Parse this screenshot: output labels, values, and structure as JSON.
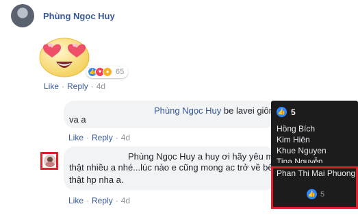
{
  "comment": {
    "author": "Phùng Ngọc Huy",
    "reaction_count": "65",
    "actions": {
      "like": "Like",
      "reply": "Reply",
      "time": "4d"
    }
  },
  "reply1": {
    "name": "Phùng Ngọc Huy",
    "text_inline": " be lavei giôn",
    "text_line2": "va a",
    "actions": {
      "like": "Like",
      "reply": "Reply",
      "time": "4d"
    }
  },
  "reply2": {
    "name": "Phùng Ngọc Huy",
    "text_inline": " a huy ơi hãy yêu mẹ",
    "text_line2": "thật nhiều a nhé...lúc nào e cũng mong ac trở về bê",
    "text_line3": "thật hp nha a.",
    "actions": {
      "like": "Like",
      "reply": "Reply",
      "time": "4d"
    }
  },
  "tooltip": {
    "count": "5",
    "names": [
      "Hồng Bích",
      "Kim Hiên",
      "Khue Nguyen",
      "Tina Nguyễn"
    ],
    "highlighted": "Phan Thi Mai Phuong",
    "like_count": "5"
  },
  "colors": {
    "link": "#365899",
    "like_blue": "#2d88ff",
    "highlight": "#e0202a"
  },
  "icons": [
    "avatar",
    "heart-eyes-emoji",
    "like-icon",
    "love-icon",
    "haha-icon"
  ]
}
